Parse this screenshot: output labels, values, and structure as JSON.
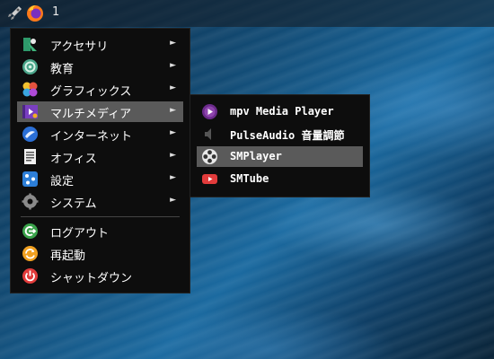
{
  "panel": {
    "workspace_number": "1"
  },
  "main_menu": {
    "items": [
      {
        "label": "アクセサリ",
        "icon": "accessories-icon"
      },
      {
        "label": "教育",
        "icon": "education-icon"
      },
      {
        "label": "グラフィックス",
        "icon": "graphics-icon"
      },
      {
        "label": "マルチメディア",
        "icon": "multimedia-icon"
      },
      {
        "label": "インターネット",
        "icon": "internet-icon"
      },
      {
        "label": "オフィス",
        "icon": "office-icon"
      },
      {
        "label": "設定",
        "icon": "settings-icon"
      },
      {
        "label": "システム",
        "icon": "system-icon"
      }
    ],
    "session_items": [
      {
        "label": "ログアウト",
        "icon": "logout-icon"
      },
      {
        "label": "再起動",
        "icon": "reboot-icon"
      },
      {
        "label": "シャットダウン",
        "icon": "shutdown-icon"
      }
    ],
    "submenu_arrow": "►"
  },
  "sub_menu": {
    "items": [
      {
        "label": "mpv Media Player",
        "icon": "mpv-icon"
      },
      {
        "label": "PulseAudio 音量調節",
        "icon": "speaker-icon"
      },
      {
        "label": "SMPlayer",
        "icon": "smplayer-icon"
      },
      {
        "label": "SMTube",
        "icon": "smtube-icon"
      }
    ]
  },
  "colors": {
    "menu_bg": "#0d0d0d",
    "active_bg": "#5a5a5a",
    "desktop": "#1b6aa0"
  }
}
